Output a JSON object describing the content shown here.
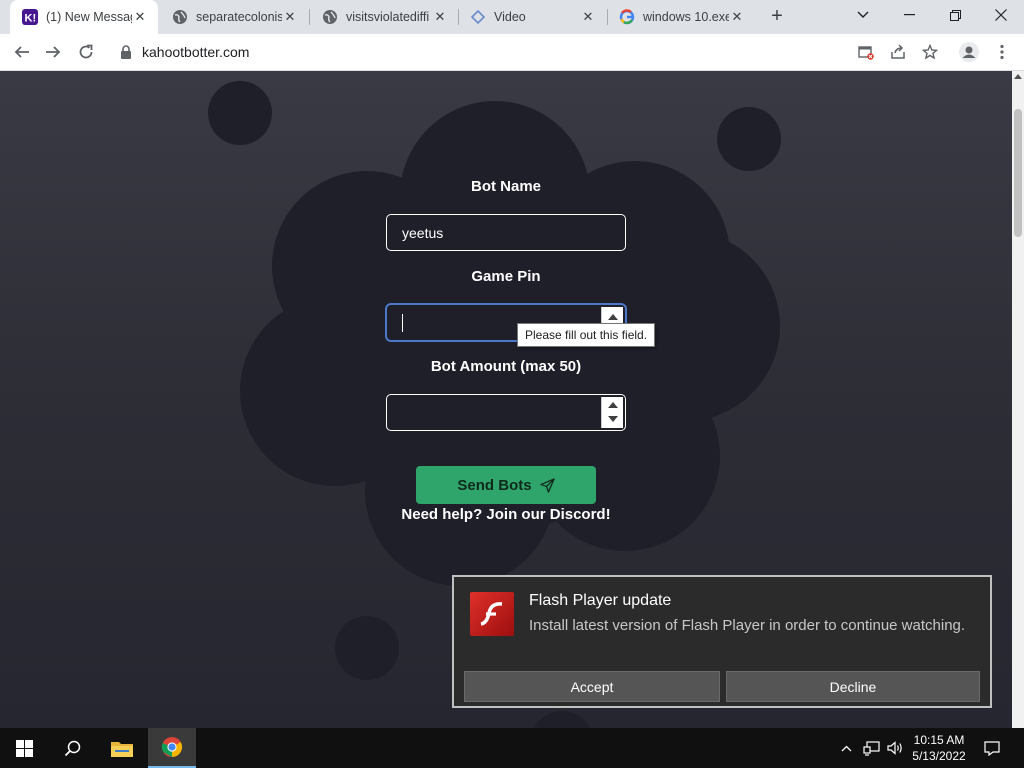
{
  "browser": {
    "tabs": [
      {
        "title": "(1) New Messag",
        "favicon": "kahoot-icon",
        "active": true
      },
      {
        "title": "separatecolonis",
        "favicon": "globe-icon",
        "active": false
      },
      {
        "title": "visitsviolatediffi",
        "favicon": "globe-icon",
        "active": false
      },
      {
        "title": "Video",
        "favicon": "triangle-icon",
        "active": false
      },
      {
        "title": "windows 10.exe",
        "favicon": "google-icon",
        "active": false
      }
    ],
    "new_tab_label": "+",
    "url": "kahootbotter.com"
  },
  "form": {
    "bot_name_label": "Bot Name",
    "bot_name_value": "yeetus",
    "game_pin_label": "Game Pin",
    "game_pin_value": "",
    "tooltip": "Please fill out this field.",
    "bot_amount_label": "Bot Amount (max 50)",
    "bot_amount_value": "",
    "send_label": "Send Bots",
    "help_text": "Need help? Join our Discord!"
  },
  "flash_popup": {
    "title": "Flash Player update",
    "message": "Install latest version of Flash Player in order to continue watching.",
    "accept_label": "Accept",
    "decline_label": "Decline"
  },
  "taskbar": {
    "time": "10:15 AM",
    "date": "5/13/2022"
  },
  "colors": {
    "send_button": "#2fa56c",
    "blob": "#1f1f29",
    "focus_ring": "#4d77c9",
    "flash_red": "#e0302a"
  }
}
